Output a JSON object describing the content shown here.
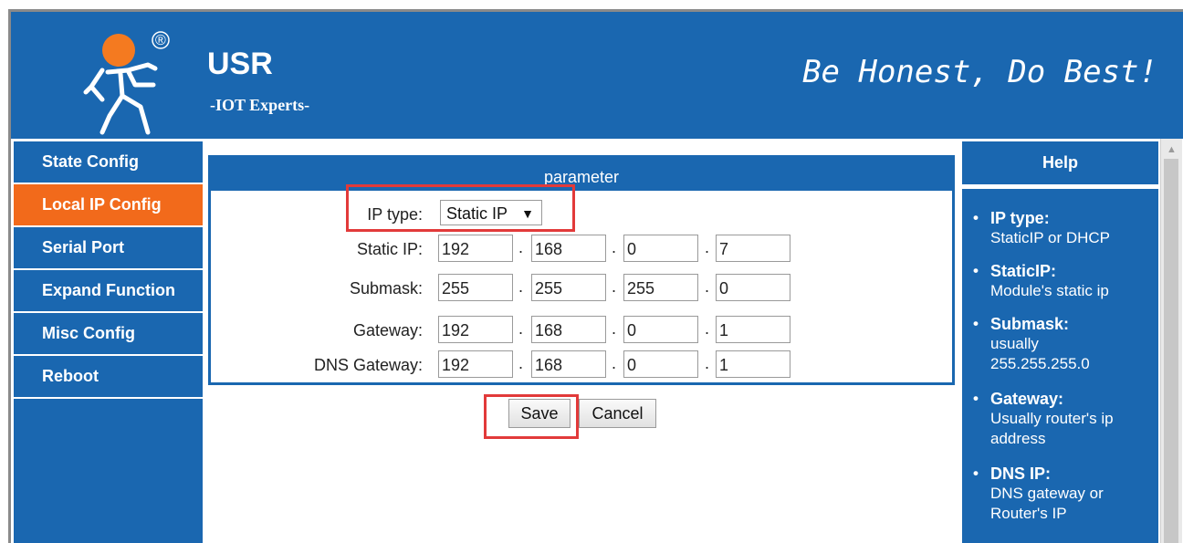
{
  "header": {
    "brand": "USR",
    "subtitle": "-IOT Experts-",
    "slogan": "Be Honest, Do Best!",
    "registered_mark": "®"
  },
  "sidebar": {
    "items": [
      {
        "label": "State Config",
        "active": false
      },
      {
        "label": "Local IP Config",
        "active": true
      },
      {
        "label": "Serial Port",
        "active": false
      },
      {
        "label": "Expand Function",
        "active": false
      },
      {
        "label": "Misc Config",
        "active": false
      },
      {
        "label": "Reboot",
        "active": false
      }
    ]
  },
  "panel": {
    "title": "parameter",
    "ip_type": {
      "label": "IP type:",
      "value": "Static IP"
    },
    "static_ip": {
      "label": "Static IP:",
      "octets": [
        "192",
        "168",
        "0",
        "7"
      ]
    },
    "submask": {
      "label": "Submask:",
      "octets": [
        "255",
        "255",
        "255",
        "0"
      ]
    },
    "gateway": {
      "label": "Gateway:",
      "octets": [
        "192",
        "168",
        "0",
        "1"
      ]
    },
    "dns_gateway": {
      "label": "DNS Gateway:",
      "octets": [
        "192",
        "168",
        "0",
        "1"
      ]
    }
  },
  "buttons": {
    "save": "Save",
    "cancel": "Cancel"
  },
  "help": {
    "title": "Help",
    "items": [
      {
        "term": "IP type:",
        "desc": [
          "StaticIP or DHCP"
        ]
      },
      {
        "term": "StaticIP:",
        "desc": [
          "Module's static ip"
        ]
      },
      {
        "term": "Submask:",
        "desc": [
          "usually",
          "255.255.255.0"
        ]
      },
      {
        "term": "Gateway:",
        "desc": [
          "Usually router's ip",
          "address"
        ]
      },
      {
        "term": "DNS IP:",
        "desc": [
          "DNS gateway or",
          "Router's IP"
        ]
      }
    ]
  },
  "colors": {
    "primary_blue": "#1a67b0",
    "active_orange": "#f26a1b",
    "logo_orange": "#f47a20",
    "highlight_red": "#e23a3a"
  }
}
